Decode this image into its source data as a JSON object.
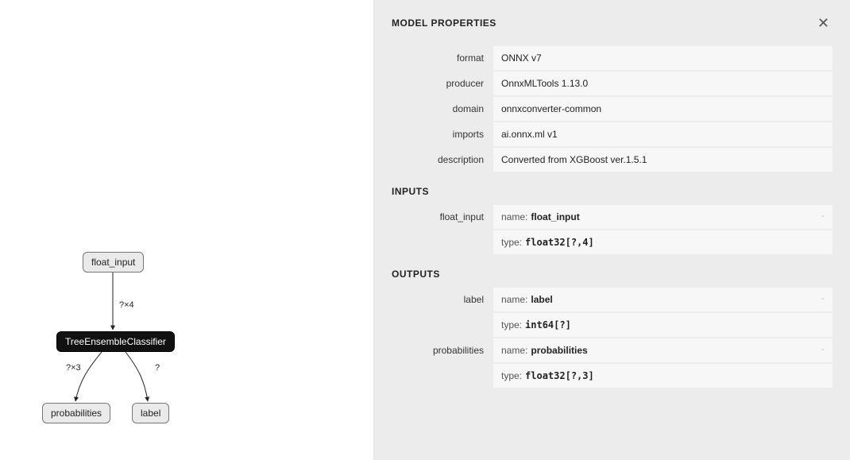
{
  "graph": {
    "input_node": "float_input",
    "op_node": "TreeEnsembleClassifier",
    "output_left": "probabilities",
    "output_right": "label",
    "edge_top": "?×4",
    "edge_left": "?×3",
    "edge_right": "?"
  },
  "panel": {
    "title": "MODEL PROPERTIES",
    "props": {
      "format": {
        "label": "format",
        "value": "ONNX v7"
      },
      "producer": {
        "label": "producer",
        "value": "OnnxMLTools 1.13.0"
      },
      "domain": {
        "label": "domain",
        "value": "onnxconverter-common"
      },
      "imports": {
        "label": "imports",
        "value": "ai.onnx.ml v1"
      },
      "description": {
        "label": "description",
        "value": "Converted from XGBoost ver.1.5.1"
      }
    },
    "inputs_heading": "INPUTS",
    "inputs": {
      "float_input": {
        "label": "float_input",
        "name_key": "name:",
        "name_val": "float_input",
        "type_key": "type:",
        "type_val": "float32[?,4]"
      }
    },
    "outputs_heading": "OUTPUTS",
    "outputs": {
      "label": {
        "label": "label",
        "name_key": "name:",
        "name_val": "label",
        "type_key": "type:",
        "type_val": "int64[?]"
      },
      "probabilities": {
        "label": "probabilities",
        "name_key": "name:",
        "name_val": "probabilities",
        "type_key": "type:",
        "type_val": "float32[?,3]"
      }
    }
  }
}
